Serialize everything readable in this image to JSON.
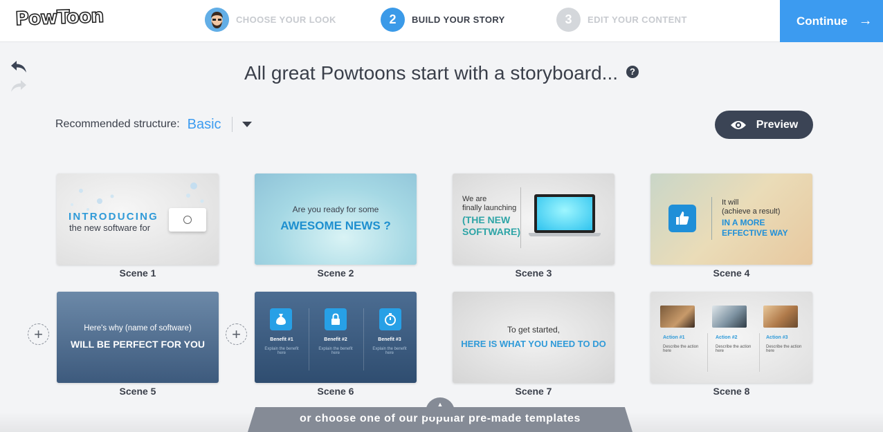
{
  "header": {
    "logo_text": "PowToon",
    "steps": [
      {
        "number": "1",
        "label": "CHOOSE YOUR LOOK",
        "state": "completed",
        "icon": "avatar"
      },
      {
        "number": "2",
        "label": "BUILD YOUR STORY",
        "state": "active"
      },
      {
        "number": "3",
        "label": "EDIT YOUR CONTENT",
        "state": "upcoming"
      }
    ],
    "continue_label": "Continue",
    "continue_icon": "arrow-right-icon"
  },
  "history": {
    "undo_icon": "undo-icon",
    "redo_icon": "redo-icon"
  },
  "headline": {
    "text": "All great Powtoons start with a storyboard...",
    "help": "?"
  },
  "structure": {
    "label": "Recommended structure:",
    "value": "Basic"
  },
  "preview_label": "Preview",
  "scenes": [
    {
      "label": "Scene 1",
      "lines": [
        "INTRODUCING",
        "the new software for"
      ]
    },
    {
      "label": "Scene 2",
      "lines": [
        "Are you ready for some",
        "AWESOME NEWS ?"
      ]
    },
    {
      "label": "Scene 3",
      "lines": [
        "We are",
        "finally launching",
        "(THE NEW",
        "SOFTWARE)"
      ]
    },
    {
      "label": "Scene 4",
      "lines": [
        "It will",
        "(achieve a result)",
        "IN A MORE",
        "EFFECTIVE WAY"
      ]
    },
    {
      "label": "Scene 5",
      "lines": [
        "Here's why (name of software)",
        "WILL BE PERFECT FOR YOU"
      ]
    },
    {
      "label": "Scene 6",
      "benefits": [
        {
          "title": "Benefit #1",
          "desc": "Explain the benefit here"
        },
        {
          "title": "Benefit #2",
          "desc": "Explain the benefit here"
        },
        {
          "title": "Benefit #3",
          "desc": "Explain the benefit here"
        }
      ]
    },
    {
      "label": "Scene 7",
      "lines": [
        "To get started,",
        "HERE IS WHAT YOU  NEED TO DO"
      ]
    },
    {
      "label": "Scene 8",
      "actions": [
        {
          "title": "Action #1",
          "desc": "Describe the action here"
        },
        {
          "title": "Action #2",
          "desc": "Describe the action here"
        },
        {
          "title": "Action #3",
          "desc": "Describe the action here"
        }
      ]
    }
  ],
  "templates_label": "or choose one of our popular pre-made templates",
  "colors": {
    "accent": "#3c9bf0",
    "dark": "#3b4455",
    "text": "#3a3f4a"
  }
}
